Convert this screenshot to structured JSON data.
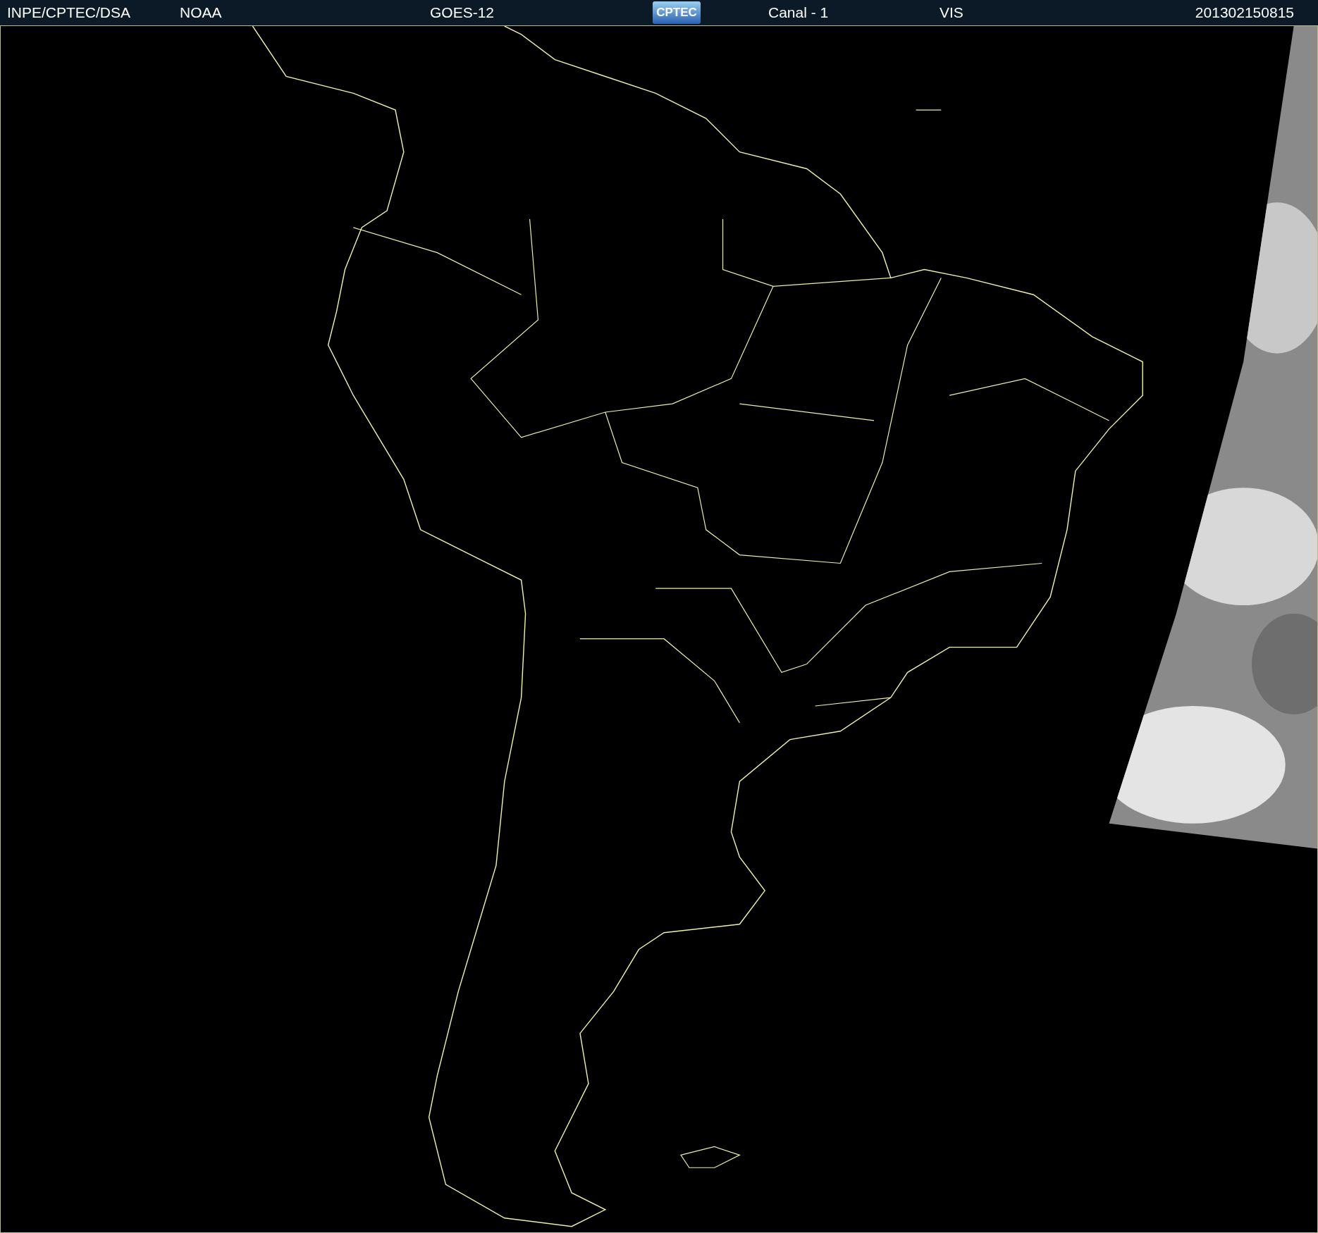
{
  "header": {
    "items": [
      {
        "kind": "text",
        "text": "INPE/CPTEC/DSA"
      },
      {
        "kind": "text",
        "text": "NOAA"
      },
      {
        "kind": "text",
        "text": "GOES-12"
      },
      {
        "kind": "logo",
        "text": "CPTEC"
      },
      {
        "kind": "text",
        "text": "Canal - 1"
      },
      {
        "kind": "text",
        "text": "VIS"
      },
      {
        "kind": "text",
        "text": "201302150815"
      }
    ]
  }
}
